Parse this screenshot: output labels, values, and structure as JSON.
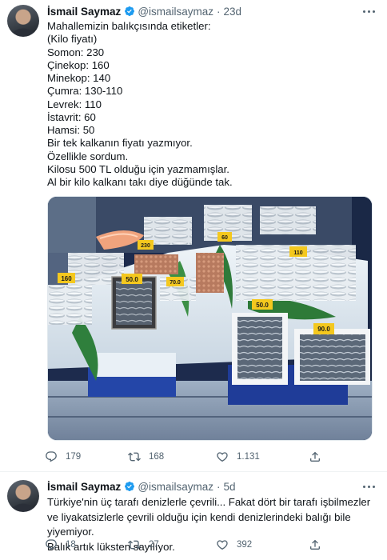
{
  "tweets": [
    {
      "display_name": "İsmail Saymaz",
      "handle": "@ismailsaymaz",
      "separator": "·",
      "time": "23d",
      "lines": [
        "Mahallemizin balıkçısında etiketler:",
        "(Kilo fiyatı)",
        "Somon: 230",
        "Çinekop: 160",
        "Minekop: 140",
        "Çumra: 130-110",
        "Levrek: 110",
        "İstavrit: 60",
        "Hamsi: 50",
        "Bir tek kalkanın fiyatı yazmıyor.",
        "Özellikle sordum.",
        "Kilosu 500 TL olduğu için yazmamışlar.",
        "Al bir kilo kalkanı takı diye düğünde tak."
      ],
      "media": {
        "price_tags": [
          "230",
          "160",
          "50.0",
          "70.0",
          "60",
          "110",
          "50.0",
          "90.0"
        ]
      },
      "actions": {
        "reply_count": "179",
        "retweet_count": "168",
        "like_count": "1.131"
      }
    },
    {
      "display_name": "İsmail Saymaz",
      "handle": "@ismailsaymaz",
      "separator": "·",
      "time": "5d",
      "paragraphs": [
        "Türkiye'nin üç tarafı denizlerle çevrili... Fakat dört bir tarafı işbilmezler ve liyakatsizlerle çevrili olduğu için kendi denizlerindeki balığı bile yiyemiyor.",
        "Balık artık lüksten sayılıyor."
      ],
      "actions": {
        "reply_count": "18",
        "retweet_count": "27",
        "like_count": "392"
      }
    }
  ],
  "icons": {
    "verified": "verified-badge-icon",
    "reply": "reply-icon",
    "retweet": "retweet-icon",
    "like": "like-icon",
    "share": "share-icon",
    "more": "more-options-icon"
  },
  "colors": {
    "text": "#0f1419",
    "secondary": "#536471",
    "verified_blue": "#1d9bf0",
    "divider": "#eff3f4"
  }
}
